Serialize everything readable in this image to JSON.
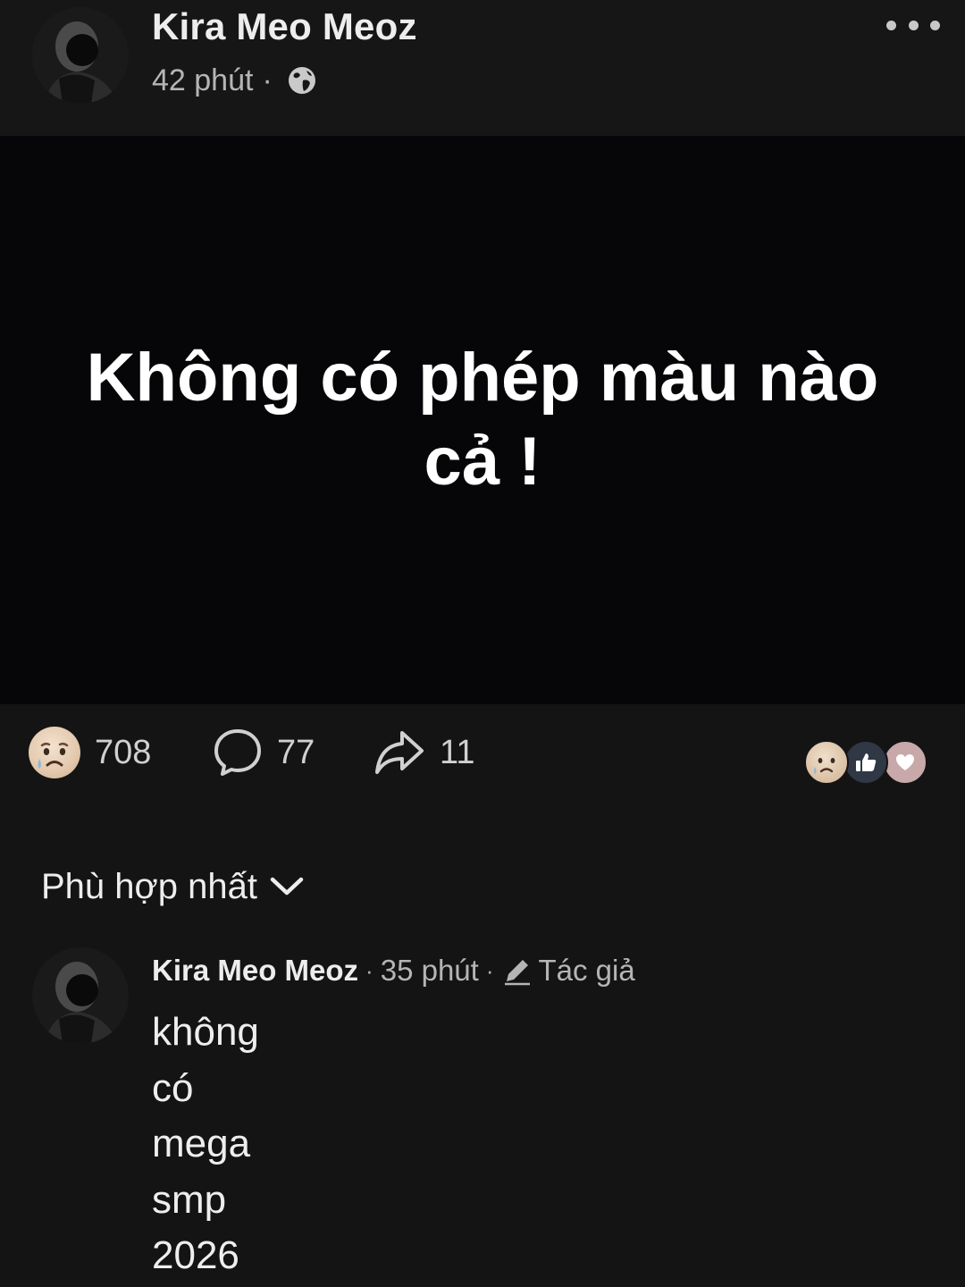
{
  "post": {
    "author": "Kira Meo Meoz",
    "time": "42 phút",
    "separator": "·",
    "privacy_icon": "globe-icon",
    "more_icon": "more-horizontal-icon",
    "text": "Không có phép màu nào cả !",
    "background_color": "#060608"
  },
  "actions": {
    "reaction_icon": "sad-emoji-icon",
    "reaction_count": "708",
    "comment_icon": "comment-bubble-icon",
    "comment_count": "77",
    "share_icon": "share-arrow-icon",
    "share_count": "11"
  },
  "reaction_summary": [
    "sad",
    "like",
    "love"
  ],
  "sort": {
    "label": "Phù hợp nhất",
    "icon": "chevron-down-icon"
  },
  "comment": {
    "author": "Kira Meo Meoz",
    "separator": "·",
    "time": "35 phút",
    "badge_icon": "pencil-icon",
    "badge": "Tác giả",
    "lines": [
      "không",
      "có",
      "mega",
      "smp",
      "2026"
    ]
  }
}
